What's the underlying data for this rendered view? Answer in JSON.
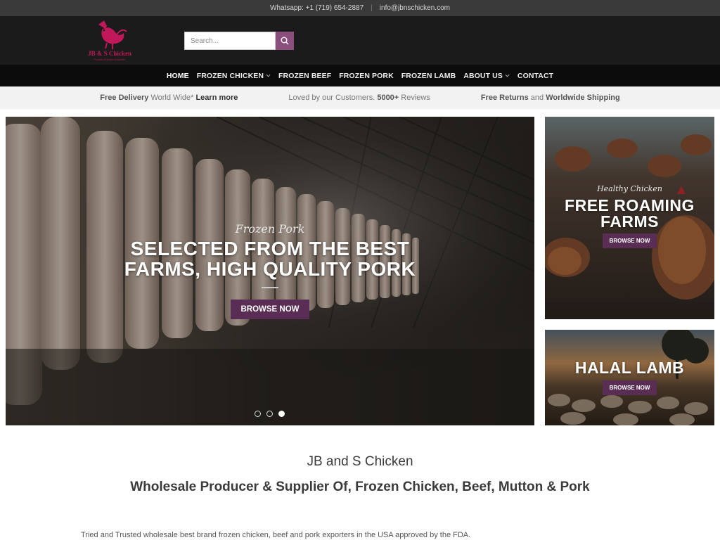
{
  "topbar": {
    "whatsapp": "Whatsapp: +1 (719) 654-2887",
    "separator": "|",
    "email": "info@jbnschicken.com"
  },
  "logo": {
    "name": "JB & S Chicken",
    "tagline": "Frozen Chicken Exporter",
    "brand_color": "#c0185a"
  },
  "search": {
    "placeholder": "Search...",
    "icon": "search-icon",
    "button_color": "#8a4f7d"
  },
  "nav": {
    "items": [
      {
        "label": "HOME",
        "active": true,
        "dropdown": false
      },
      {
        "label": "FROZEN CHICKEN",
        "active": false,
        "dropdown": true
      },
      {
        "label": "FROZEN BEEF",
        "active": false,
        "dropdown": false
      },
      {
        "label": "FROZEN PORK",
        "active": false,
        "dropdown": false
      },
      {
        "label": "FROZEN LAMB",
        "active": false,
        "dropdown": false
      },
      {
        "label": "ABOUT US",
        "active": false,
        "dropdown": true
      },
      {
        "label": "CONTACT",
        "active": false,
        "dropdown": false
      }
    ]
  },
  "promo": {
    "delivery_bold": "Free Delivery",
    "delivery_rest": " World Wide*",
    "learn_more": "Learn more",
    "loved_text": "Loved by our Customers.",
    "reviews": "5000+",
    "reviews_rest": " Reviews",
    "returns_bold": "Free Returns",
    "returns_mid": " and ",
    "shipping_bold": "Worldwide Shipping"
  },
  "hero": {
    "kicker": "Frozen Pork",
    "headline_line1": "SELECTED FROM THE BEST",
    "headline_line2": "FARMS, HIGH QUALITY PORK",
    "button": "BROWSE NOW",
    "slide_count": 3,
    "active_slide": 3
  },
  "banner_roaming": {
    "kicker": "Healthy Chicken",
    "line1": "FREE ROAMING",
    "line2": "FARMS",
    "button": "BROWSE NOW"
  },
  "banner_lamb": {
    "title": "HALAL LAMB",
    "button": "BROWSE NOW"
  },
  "intro": {
    "title": "JB and S Chicken",
    "subtitle": "Wholesale Producer & Supplier Of, Frozen Chicken, Beef, Mutton & Pork",
    "description": "Tried and Trusted wholesale best brand frozen chicken, beef and pork exporters in the USA approved by the FDA."
  },
  "colors": {
    "accent": "#5a2d55",
    "nav_bg": "#0c0c0c",
    "header_bg": "#1b1b1b",
    "topbar_bg": "#3a3a3a"
  }
}
